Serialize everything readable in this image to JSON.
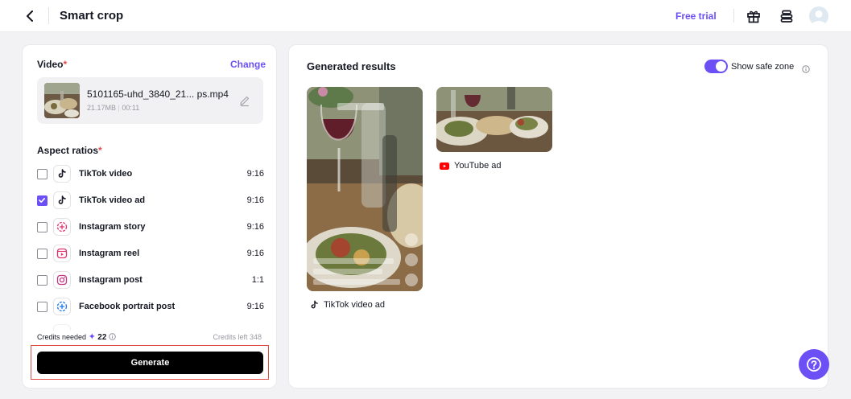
{
  "header": {
    "title": "Smart crop",
    "free_trial": "Free trial",
    "icons": [
      "back-arrow-icon",
      "gift-icon",
      "stack-icon",
      "user-avatar"
    ]
  },
  "video": {
    "label": "Video",
    "required_mark": "*",
    "change": "Change",
    "file_name": "5101165-uhd_3840_21...  ps.mp4",
    "file_size": "21.17MB",
    "separator": "|",
    "duration": "00:11"
  },
  "aspect": {
    "label": "Aspect ratios",
    "required_mark": "*",
    "items": [
      {
        "name": "TikTok video",
        "ratio": "9:16",
        "checked": false,
        "icon": "tiktok-icon"
      },
      {
        "name": "TikTok video ad",
        "ratio": "9:16",
        "checked": true,
        "icon": "tiktok-icon"
      },
      {
        "name": "Instagram story",
        "ratio": "9:16",
        "checked": false,
        "icon": "instagram-story-icon"
      },
      {
        "name": "Instagram reel",
        "ratio": "9:16",
        "checked": false,
        "icon": "instagram-reel-icon"
      },
      {
        "name": "Instagram post",
        "ratio": "1:1",
        "checked": false,
        "icon": "instagram-icon"
      },
      {
        "name": "Facebook portrait post",
        "ratio": "9:16",
        "checked": false,
        "icon": "facebook-story-icon"
      }
    ]
  },
  "credits": {
    "needed_label": "Credits needed",
    "needed_value": "22",
    "left_label": "Credits left 348"
  },
  "generate_label": "Generate",
  "results": {
    "title": "Generated results",
    "safe_zone_label": "Show safe zone",
    "safe_zone_on": true,
    "items": [
      {
        "label": "TikTok video ad",
        "icon": "tiktok-icon"
      },
      {
        "label": "YouTube ad",
        "icon": "youtube-icon"
      }
    ]
  },
  "colors": {
    "accent": "#6c4ff5",
    "required": "#e5484d",
    "youtube": "#ff0000",
    "highlight_frame": "#e04b43"
  }
}
